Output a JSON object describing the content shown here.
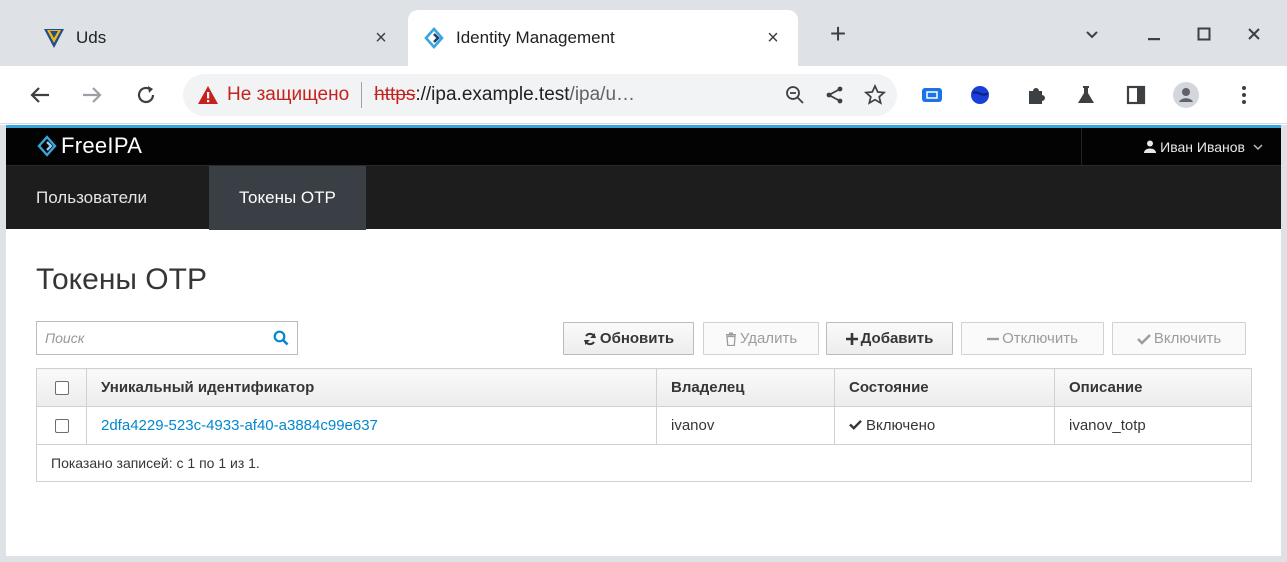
{
  "browser": {
    "tabs": [
      {
        "title": "Uds",
        "close": "×",
        "active": false
      },
      {
        "title": "Identity Management",
        "close": "×",
        "active": true
      }
    ],
    "new_tab": "+",
    "address": {
      "insecure_label": "Не защищено",
      "scheme": "https",
      "host": "://ipa.example.test",
      "path": "/ipa/u…"
    },
    "colors": {
      "insecure": "#c5221f",
      "tabstrip": "#dee1e6"
    }
  },
  "ipa": {
    "brand": "FreeIPA",
    "user": "Иван Иванов",
    "nav": {
      "users": "Пользователи",
      "otp_tokens": "Токены OTP"
    },
    "page_title": "Токены OTP",
    "search_placeholder": "Поиск",
    "actions": {
      "refresh": "Обновить",
      "delete": "Удалить",
      "add": "Добавить",
      "disable": "Отключить",
      "enable": "Включить"
    },
    "table": {
      "columns": [
        "Уникальный идентификатор",
        "Владелец",
        "Состояние",
        "Описание"
      ],
      "rows": [
        {
          "id": "2dfa4229-523c-4933-af40-a3884c99e637",
          "owner": "ivanov",
          "status": "Включено",
          "description": "ivanov_totp"
        }
      ],
      "footer": "Показано записей: с 1 по 1 из 1."
    },
    "colors": {
      "accent": "#39a5dc",
      "link": "#0088ce",
      "masthead": "#030303",
      "navbar": "#1d1d1d",
      "nav_active": "#393f44"
    }
  }
}
